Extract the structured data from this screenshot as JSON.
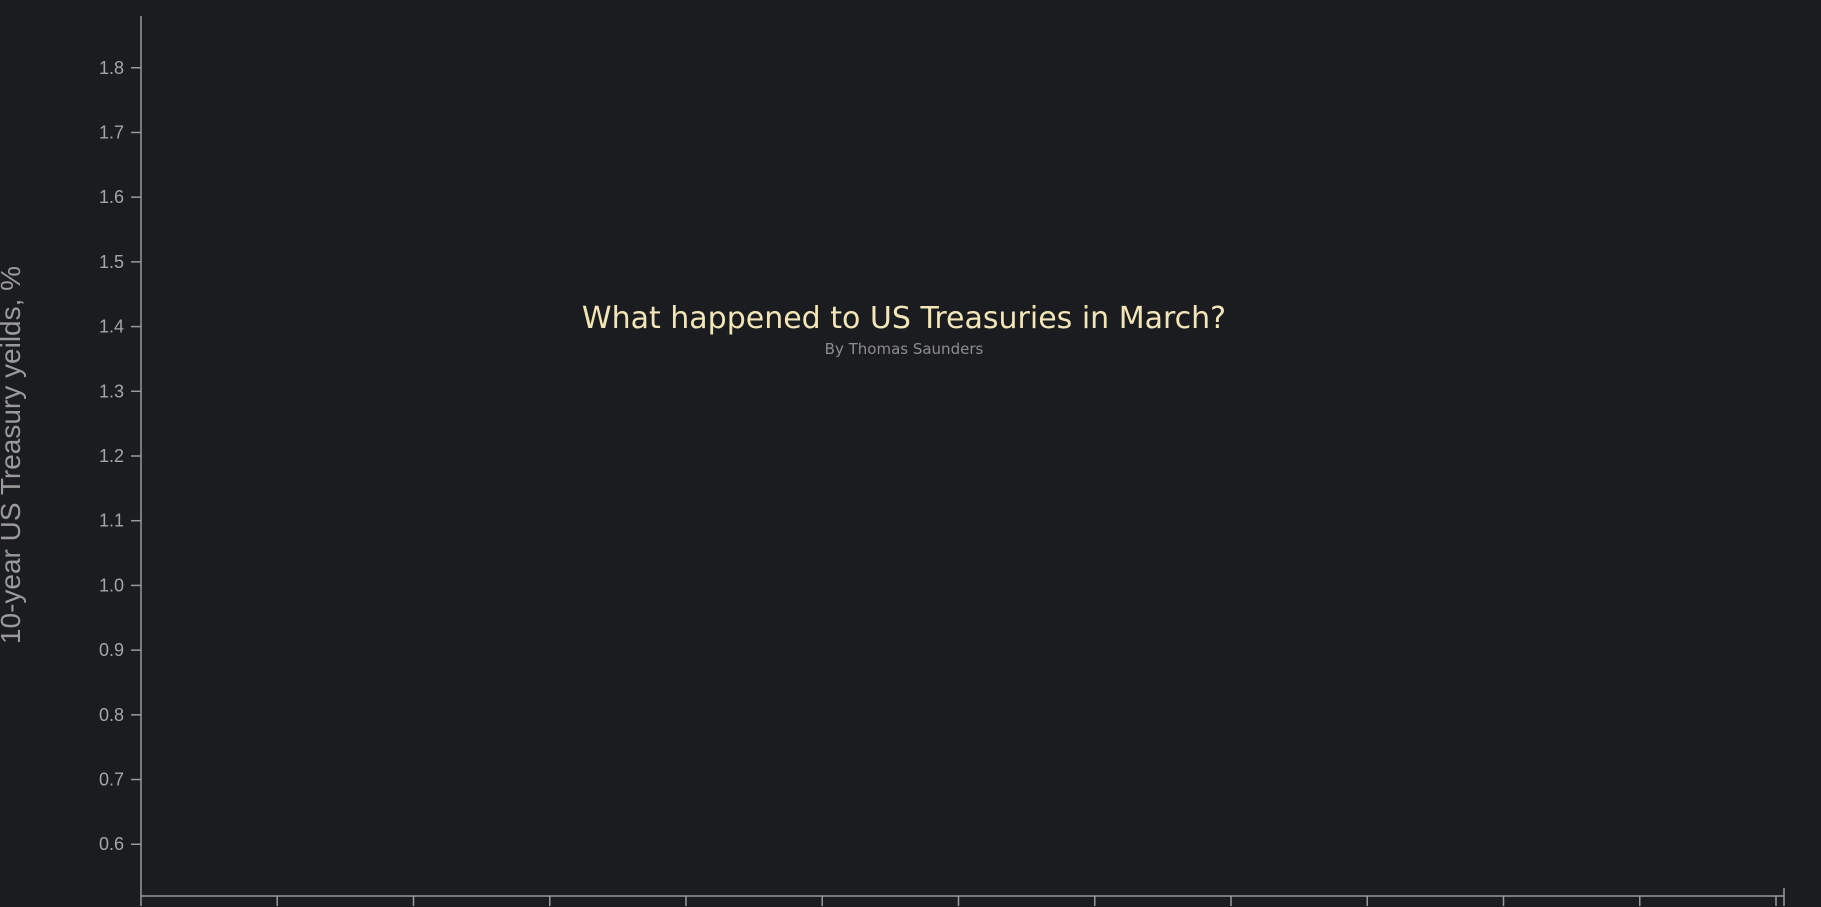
{
  "chart_data": {
    "type": "line",
    "title": "What happened to US Treasuries in March?",
    "subtitle": "By Thomas Saunders",
    "xlabel": "",
    "ylabel": "10-year US Treasury yeilds, %",
    "ylim": [
      0.52,
      1.88
    ],
    "yticks": [
      "0.6",
      "0.7",
      "0.8",
      "0.9",
      "1.0",
      "1.1",
      "1.2",
      "1.3",
      "1.4",
      "1.5",
      "1.6",
      "1.7",
      "1.8"
    ],
    "x_tick_count": 13,
    "grid": false,
    "series": []
  },
  "colors": {
    "background": "#1b1c20",
    "axis": "#9a9a9a",
    "title": "#f2e6b8",
    "subtitle": "#8d8d8d"
  }
}
